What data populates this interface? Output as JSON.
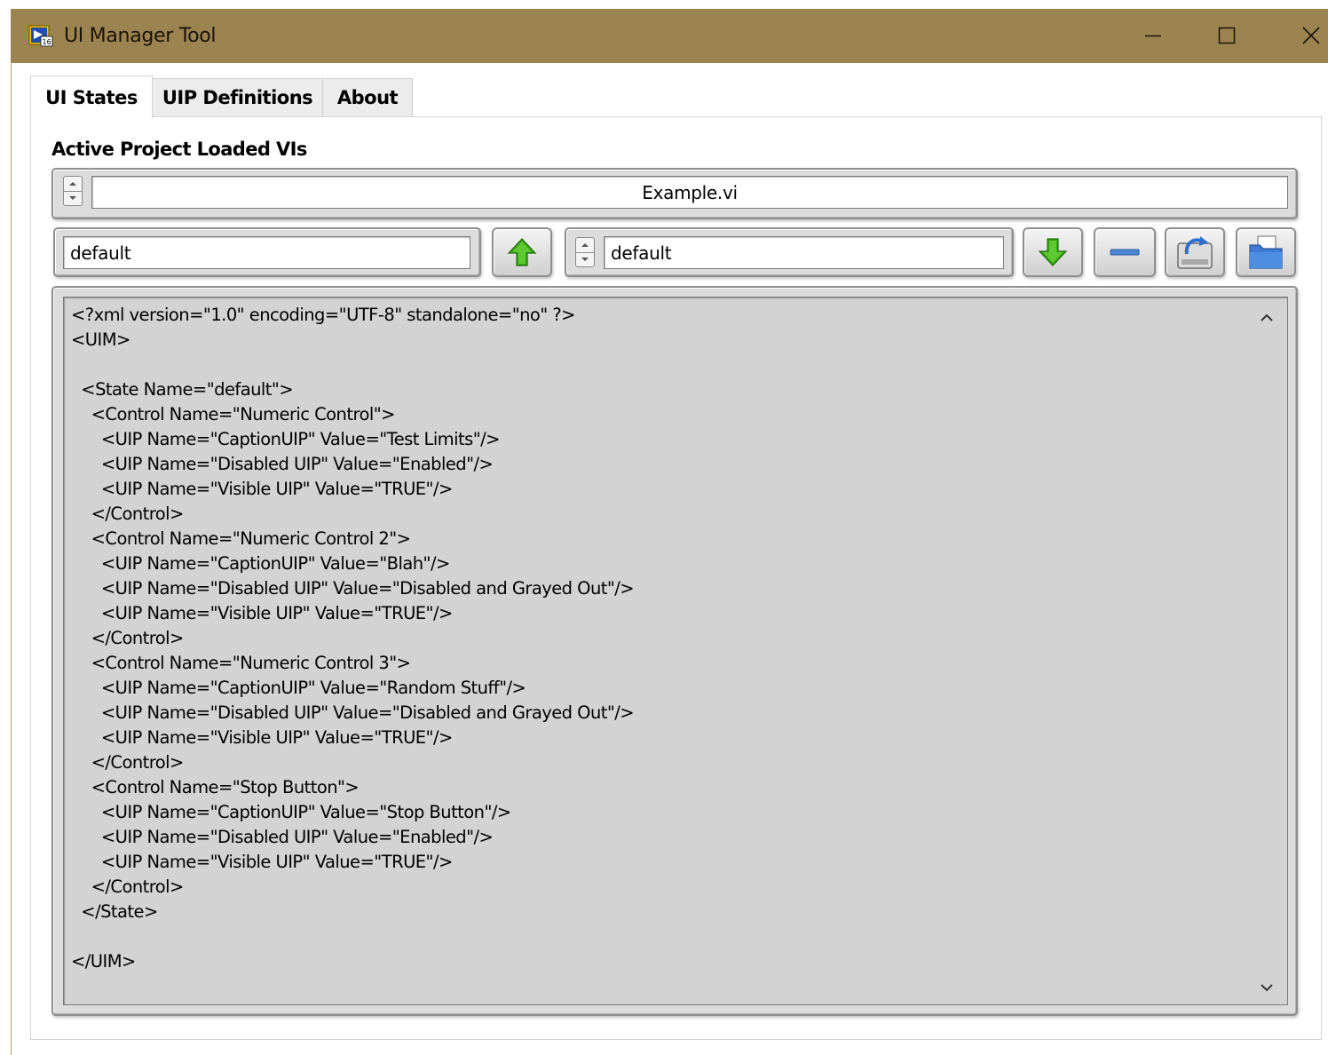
{
  "window": {
    "title": "UI Manager Tool",
    "icon": "labview-vi-icon"
  },
  "tabs": [
    {
      "label": "UI States",
      "selected": true
    },
    {
      "label": "UIP Definitions",
      "selected": false
    },
    {
      "label": "About",
      "selected": false
    }
  ],
  "panel": {
    "label": "Active Project Loaded VIs",
    "vi_selector_value": "Example.vi",
    "state_name_value": "default",
    "state_selector_value": "default",
    "toolbar_icons": [
      "upload-arrow-icon",
      "download-arrow-icon",
      "remove-icon",
      "save-icon",
      "open-folder-icon"
    ]
  },
  "xml": {
    "content": "<?xml version=\"1.0\" encoding=\"UTF-8\" standalone=\"no\" ?>\n<UIM>\n\n  <State Name=\"default\">\n    <Control Name=\"Numeric Control\">\n      <UIP Name=\"CaptionUIP\" Value=\"Test Limits\"/>\n      <UIP Name=\"Disabled UIP\" Value=\"Enabled\"/>\n      <UIP Name=\"Visible UIP\" Value=\"TRUE\"/>\n    </Control>\n    <Control Name=\"Numeric Control 2\">\n      <UIP Name=\"CaptionUIP\" Value=\"Blah\"/>\n      <UIP Name=\"Disabled UIP\" Value=\"Disabled and Grayed Out\"/>\n      <UIP Name=\"Visible UIP\" Value=\"TRUE\"/>\n    </Control>\n    <Control Name=\"Numeric Control 3\">\n      <UIP Name=\"CaptionUIP\" Value=\"Random Stuff\"/>\n      <UIP Name=\"Disabled UIP\" Value=\"Disabled and Grayed Out\"/>\n      <UIP Name=\"Visible UIP\" Value=\"TRUE\"/>\n    </Control>\n    <Control Name=\"Stop Button\">\n      <UIP Name=\"CaptionUIP\" Value=\"Stop Button\"/>\n      <UIP Name=\"Disabled UIP\" Value=\"Enabled\"/>\n      <UIP Name=\"Visible UIP\" Value=\"TRUE\"/>\n    </Control>\n  </State>\n\n</UIM>"
  },
  "colors": {
    "titlebar": "#9c8450",
    "text_area_bg": "#d3d3d3",
    "frame_bg": "#dcdcdc",
    "arrow_green": "#3aa516"
  }
}
